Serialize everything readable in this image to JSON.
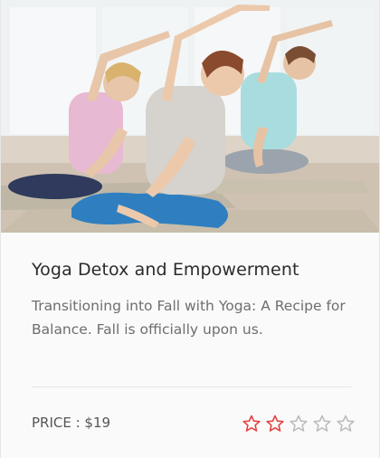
{
  "card": {
    "title": "Yoga Detox and Empowerment",
    "description": "Transitioning into Fall with Yoga: A Recipe for Balance. Fall is officially upon us.",
    "price_label": "PRICE : $19",
    "rating": {
      "value": 2,
      "max": 5
    },
    "image": {
      "subject": "three-women-yoga-side-stretch-photo"
    }
  },
  "colors": {
    "star_filled": "#e8403f",
    "star_empty": "#bcbcbc",
    "title": "#2b2b2b",
    "text": "#6e6e6e"
  }
}
